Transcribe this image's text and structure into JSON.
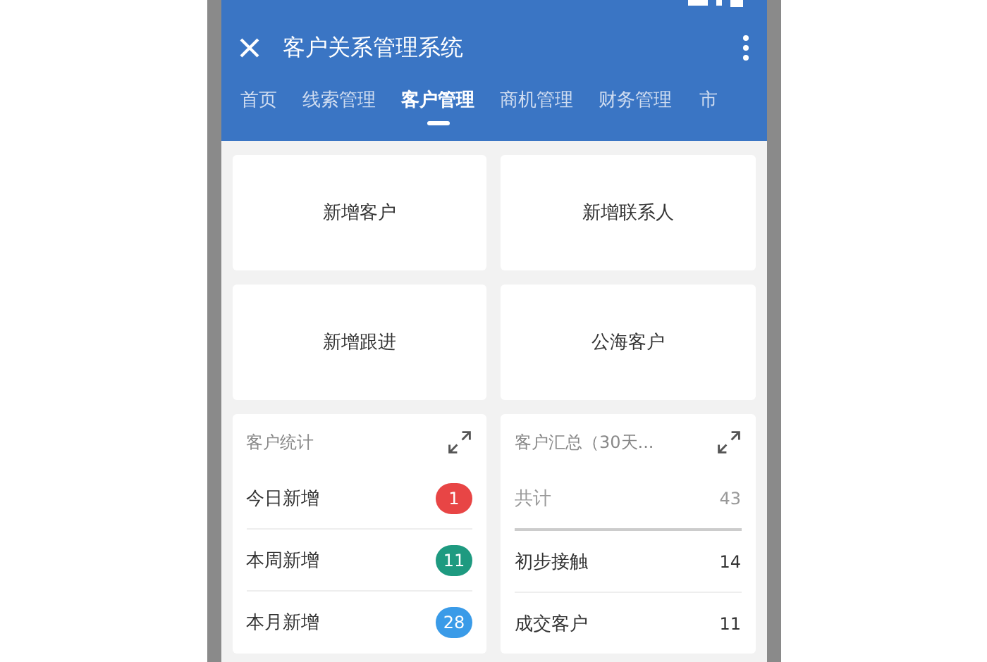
{
  "app_bar": {
    "title": "客户关系管理系统"
  },
  "tabs": [
    {
      "label": "首页",
      "selected": false
    },
    {
      "label": "线索管理",
      "selected": false
    },
    {
      "label": "客户管理",
      "selected": true
    },
    {
      "label": "商机管理",
      "selected": false
    },
    {
      "label": "财务管理",
      "selected": false
    },
    {
      "label": "市",
      "selected": false
    }
  ],
  "actions": [
    "新增客户",
    "新增联系人",
    "新增跟进",
    "公海客户"
  ],
  "customer_stats": {
    "title": "客户统计",
    "rows": [
      {
        "label": "今日新增",
        "count": "1",
        "color": "#e84545"
      },
      {
        "label": "本周新增",
        "count": "11",
        "color": "#1e9a80"
      },
      {
        "label": "本月新增",
        "count": "28",
        "color": "#3a9be8"
      }
    ]
  },
  "customer_summary": {
    "title": "客户汇总（30天...",
    "total_label": "共计",
    "total": "43",
    "rows": [
      {
        "label": "初步接触",
        "count": "14"
      },
      {
        "label": "成交客户",
        "count": "11"
      }
    ]
  }
}
